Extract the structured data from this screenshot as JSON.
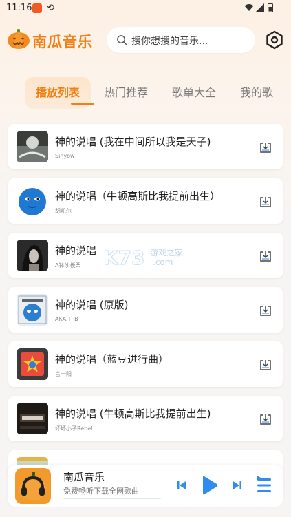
{
  "status_bar": {
    "time": "11:16"
  },
  "header": {
    "app_title": "南瓜音乐",
    "search_placeholder": "搜你想搜的音乐..."
  },
  "tabs": [
    {
      "label": "播放列表",
      "active": true
    },
    {
      "label": "热门推荐",
      "active": false
    },
    {
      "label": "歌单大全",
      "active": false
    },
    {
      "label": "我的歌",
      "active": false
    }
  ],
  "songs": [
    {
      "title": "神的说唱 (我在中间所以我是天子)",
      "artist": "Sinyow"
    },
    {
      "title": "神的说唱（牛顿高斯比我提前出生）",
      "artist": "胡凯尔"
    },
    {
      "title": "神的说唱",
      "artist": "A钵沙板栗"
    },
    {
      "title": "神的说唱 (原版)",
      "artist": "AKA.TPB"
    },
    {
      "title": "神的说唱（蓝豆进行曲）",
      "artist": "言一阳"
    },
    {
      "title": "神的说唱 (牛顿高斯比我提前出生)",
      "artist": "坏坏小子Rebel"
    }
  ],
  "player": {
    "title": "南瓜音乐",
    "subtitle": "免费畅听下载全网歌曲",
    "progress": 0.0
  },
  "watermark": {
    "brand": "K73",
    "site_cn": "游戏之家",
    "site_en": ".com"
  },
  "colors": {
    "accent": "#f08119",
    "play_blue": "#2f8cf0"
  }
}
